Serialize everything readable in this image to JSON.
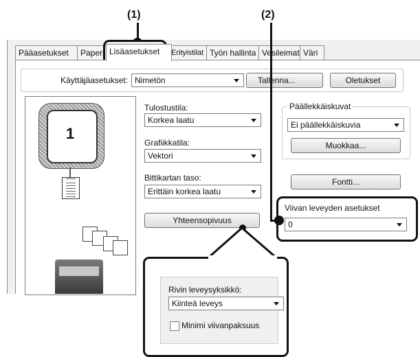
{
  "callouts": {
    "one": "(1)",
    "two": "(2)"
  },
  "tabs": [
    "Pääasetukset",
    "Paperi",
    "Lisäasetukset",
    "Erityistilat",
    "Työn hallinta",
    "Vesileimat",
    "Väri"
  ],
  "user_settings": {
    "label": "Käyttäjäasetukset:",
    "value": "Nimetön",
    "save_label": "Tallenna...",
    "defaults_label": "Oletukset"
  },
  "preview": {
    "page_number": "1"
  },
  "print_mode": {
    "label": "Tulostustila:",
    "value": "Korkea laatu"
  },
  "graphics_mode": {
    "label": "Grafiikkatila:",
    "value": "Vektori"
  },
  "bitmap_level": {
    "label": "Bittikartan taso:",
    "value": "Erittäin korkea laatu"
  },
  "compatibility_label": "Yhteensopivuus",
  "overlay": {
    "group_label": "Päällekkäiskuvat",
    "value": "Ei päällekkäiskuvia",
    "edit_label": "Muokkaa..."
  },
  "font_label": "Fontti...",
  "line_width": {
    "group_label": "Viivan leveyden asetukset",
    "value": "0"
  },
  "zoom": {
    "unit_label": "Rivin leveysyksikkö:",
    "unit_value": "Kiinteä leveys",
    "min_label": "Minimi viivanpaksuus",
    "min_checked": false
  }
}
